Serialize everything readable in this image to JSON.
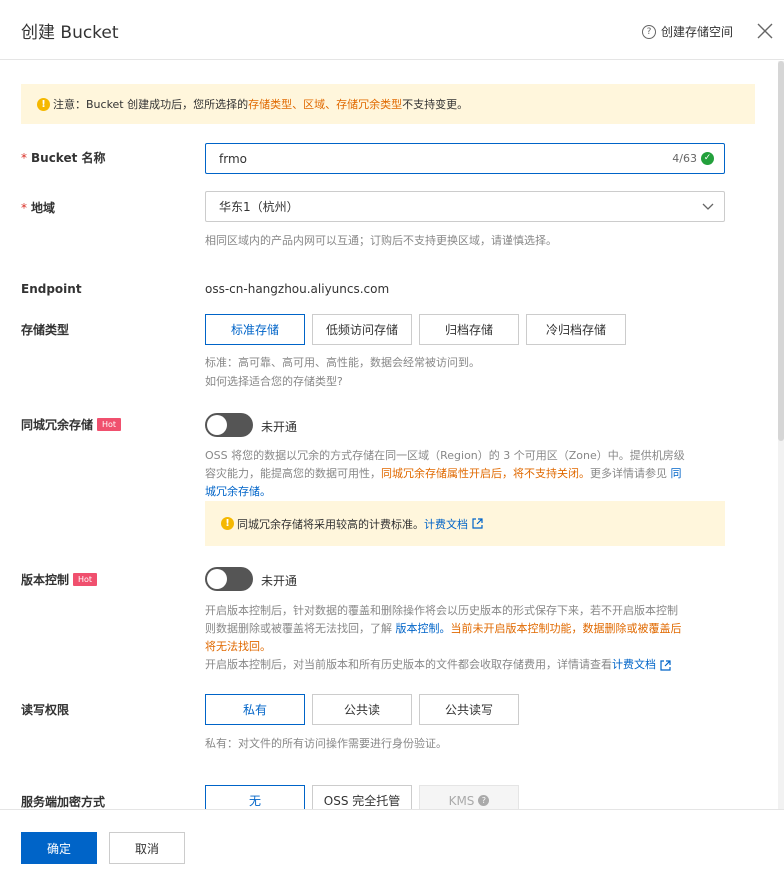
{
  "header": {
    "title": "创建 Bucket",
    "help_link": "创建存储空间"
  },
  "notice": {
    "prefix": "注意：Bucket 创建成功后，您所选择的 ",
    "highlight": "存储类型、区域、存储冗余类型",
    "suffix": " 不支持变更。"
  },
  "bucket_name": {
    "label": "Bucket 名称",
    "value": "frmo",
    "count": "4/63"
  },
  "region": {
    "label": "地域",
    "value": "华东1（杭州）",
    "help": "相同区域内的产品内网可以互通；订购后不支持更换区域，请谨慎选择。"
  },
  "endpoint": {
    "label": "Endpoint",
    "value": "oss-cn-hangzhou.aliyuncs.com"
  },
  "storage_class": {
    "label": "存储类型",
    "options": [
      "标准存储",
      "低频访问存储",
      "归档存储",
      "冷归档存储"
    ],
    "selected": "标准存储",
    "help": "标准：高可靠、高可用、高性能，数据会经常被访问到。",
    "link": "如何选择适合您的存储类型?"
  },
  "zrs": {
    "label": "同城冗余存储",
    "hot": "Hot",
    "status": "未开通",
    "enabled": false,
    "desc_line1": "OSS 将您的数据以冗余的方式存储在同一区域（Region）的 3 个可用区（Zone）中。提供机房级",
    "desc_line2_a": "容灾能力，能提高您的数据可用性，",
    "desc_line2_b": "同城冗余存储属性开启后，将不支持关闭。",
    "desc_line2_c": "更多详情请参见 ",
    "desc_line2_link": "同",
    "desc_line3_link": "城冗余存储。",
    "notice_text": "同城冗余存储将采用较高的计费标准。",
    "notice_link": "计费文档"
  },
  "versioning": {
    "label": "版本控制",
    "hot": "Hot",
    "status": "未开通",
    "enabled": false,
    "desc_line1": "开启版本控制后，针对数据的覆盖和删除操作将会以历史版本的形式保存下来，若不开启版本控制",
    "desc_line2_a": "则数据删除或被覆盖将无法找回，了解 ",
    "desc_line2_link": "版本控制。",
    "desc_line2_warn": "当前未开启版本控制功能，数据删除或被覆盖后",
    "desc_line3_warn": "将无法找回。",
    "desc_line4": "开启版本控制后，对当前版本和所有历史版本的文件都会收取存储费用，详情请查看",
    "desc_line4_link": "计费文档"
  },
  "acl": {
    "label": "读写权限",
    "options": [
      "私有",
      "公共读",
      "公共读写"
    ],
    "selected": "私有",
    "help": "私有：对文件的所有访问操作需要进行身份验证。"
  },
  "encryption": {
    "label": "服务端加密方式",
    "options": [
      "无",
      "OSS 完全托管",
      "KMS"
    ],
    "selected": "无"
  },
  "footer": {
    "confirm": "确定",
    "cancel": "取消"
  },
  "colors": {
    "primary": "#0064c8",
    "warning": "#e06900",
    "notice_bg": "#fff6dc",
    "hot": "#f0506e"
  }
}
